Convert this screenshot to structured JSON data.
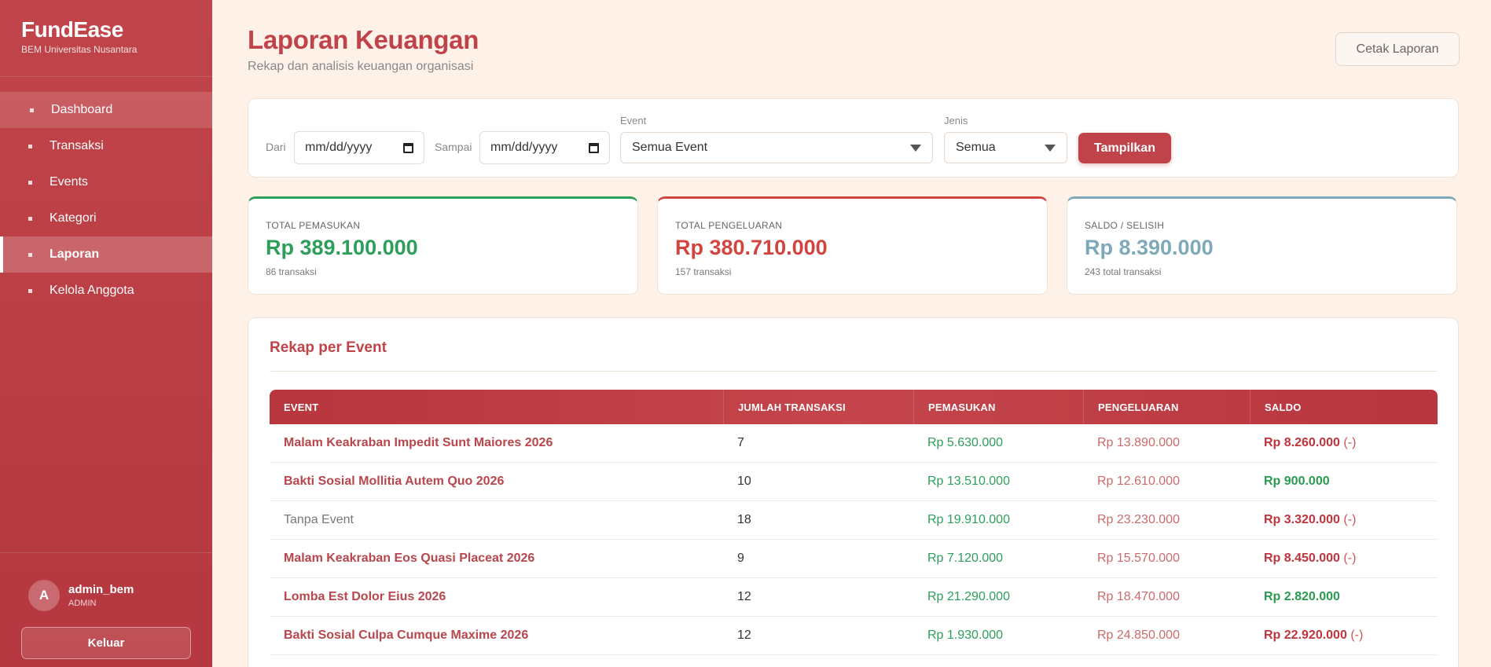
{
  "sidebar": {
    "brand": "FundEase",
    "org": "BEM Universitas Nusantara",
    "items": [
      {
        "label": "Dashboard"
      },
      {
        "label": "Transaksi"
      },
      {
        "label": "Events"
      },
      {
        "label": "Kategori"
      },
      {
        "label": "Laporan"
      },
      {
        "label": "Kelola Anggota"
      }
    ],
    "user": {
      "initial": "A",
      "name": "admin_bem",
      "role": "ADMIN"
    },
    "logout_label": "Keluar"
  },
  "header": {
    "title": "Laporan Keuangan",
    "subtitle": "Rekap dan analisis keuangan organisasi",
    "print_label": "Cetak Laporan"
  },
  "filter": {
    "from_label": "Dari",
    "to_label": "Sampai",
    "date_placeholder": "mm/dd/yyyy",
    "event_label": "Event",
    "event_value": "Semua Event",
    "type_label": "Jenis",
    "type_value": "Semua",
    "submit_label": "Tampilkan"
  },
  "stats": {
    "income": {
      "label": "TOTAL PEMASUKAN",
      "value": "Rp 389.100.000",
      "sub": "86 transaksi",
      "color": "#2e9e5b"
    },
    "expense": {
      "label": "TOTAL PENGELUARAN",
      "value": "Rp 380.710.000",
      "sub": "157 transaksi",
      "color": "#d2453f"
    },
    "balance": {
      "label": "SALDO / SELISIH",
      "value": "Rp 8.390.000",
      "sub": "243 total transaksi",
      "color": "#7ea9b8"
    }
  },
  "recap": {
    "title": "Rekap per Event",
    "columns": [
      "EVENT",
      "JUMLAH TRANSAKSI",
      "PEMASUKAN",
      "PENGELUARAN",
      "SALDO"
    ],
    "rows": [
      {
        "event": "Malam Keakraban Impedit Sunt Maiores 2026",
        "count": "7",
        "income": "Rp 5.630.000",
        "expense": "Rp 13.890.000",
        "balance": "Rp 8.260.000",
        "neg": "(-)"
      },
      {
        "event": "Bakti Sosial Mollitia Autem Quo 2026",
        "count": "10",
        "income": "Rp 13.510.000",
        "expense": "Rp 12.610.000",
        "balance": "Rp 900.000",
        "neg": ""
      },
      {
        "event": "Tanpa Event",
        "count": "18",
        "income": "Rp 19.910.000",
        "expense": "Rp 23.230.000",
        "balance": "Rp 3.320.000",
        "neg": "(-)"
      },
      {
        "event": "Malam Keakraban Eos Quasi Placeat 2026",
        "count": "9",
        "income": "Rp 7.120.000",
        "expense": "Rp 15.570.000",
        "balance": "Rp 8.450.000",
        "neg": "(-)"
      },
      {
        "event": "Lomba Est Dolor Eius 2026",
        "count": "12",
        "income": "Rp 21.290.000",
        "expense": "Rp 18.470.000",
        "balance": "Rp 2.820.000",
        "neg": ""
      },
      {
        "event": "Bakti Sosial Culpa Cumque Maxime 2026",
        "count": "12",
        "income": "Rp 1.930.000",
        "expense": "Rp 24.850.000",
        "balance": "Rp 22.920.000",
        "neg": "(-)"
      }
    ]
  }
}
